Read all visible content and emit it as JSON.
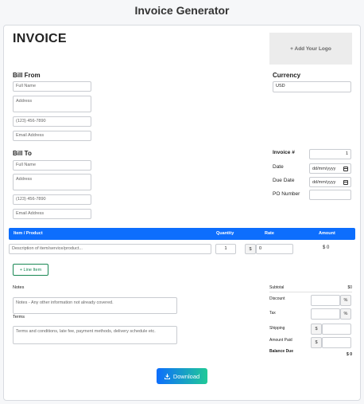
{
  "app": {
    "title": "Invoice Generator"
  },
  "invoice": {
    "heading": "INVOICE",
    "logo_label": "+ Add Your Logo",
    "bill_from": {
      "label": "Bill From",
      "full_name_ph": "Full Name",
      "address_ph": "Address",
      "phone_ph": "(123) 456-7890",
      "email_ph": "Email Address"
    },
    "currency": {
      "label": "Currency",
      "value": "USD"
    },
    "bill_to": {
      "label": "Bill To",
      "full_name_ph": "Full Name",
      "address_ph": "Address",
      "phone_ph": "(123) 456-7890",
      "email_ph": "Email Address"
    },
    "meta": {
      "invoice_no_label": "Invoice #",
      "invoice_no_value": "1",
      "date_label": "Date",
      "date_ph": "dd/mm/yyyy",
      "due_label": "Due Date",
      "due_ph": "dd/mm/yyyy",
      "po_label": "PO Number",
      "po_value": ""
    },
    "table": {
      "headers": [
        "Item / Product",
        "Quantity",
        "Rate",
        "Amount"
      ],
      "row": {
        "description_ph": "Description of item/service/product...",
        "quantity": "1",
        "currency_symbol": "$",
        "rate": "0",
        "amount": "$ 0"
      }
    },
    "line_item_button": "+ Line Item",
    "notes": {
      "label": "Notes",
      "placeholder": "Notes - Any other information not already covered."
    },
    "terms": {
      "label": "Terms",
      "placeholder": "Terms and conditions, late fee, payment methods, delivery schedule etc."
    },
    "totals": {
      "subtotal_label": "Subtotal",
      "subtotal_value": "$0",
      "discount_label": "Discount",
      "discount_suffix": "%",
      "tax_label": "Tax",
      "tax_suffix": "%",
      "shipping_label": "Shipping",
      "shipping_prefix": "$",
      "amount_paid_label": "Amount Paid",
      "amount_paid_prefix": "$",
      "balance_label": "Balance Due",
      "balance_value": "$ 0"
    },
    "download_button": "Download"
  },
  "colors": {
    "primary": "#0d6efd",
    "success": "#198754",
    "gradient_end": "#20c997"
  }
}
